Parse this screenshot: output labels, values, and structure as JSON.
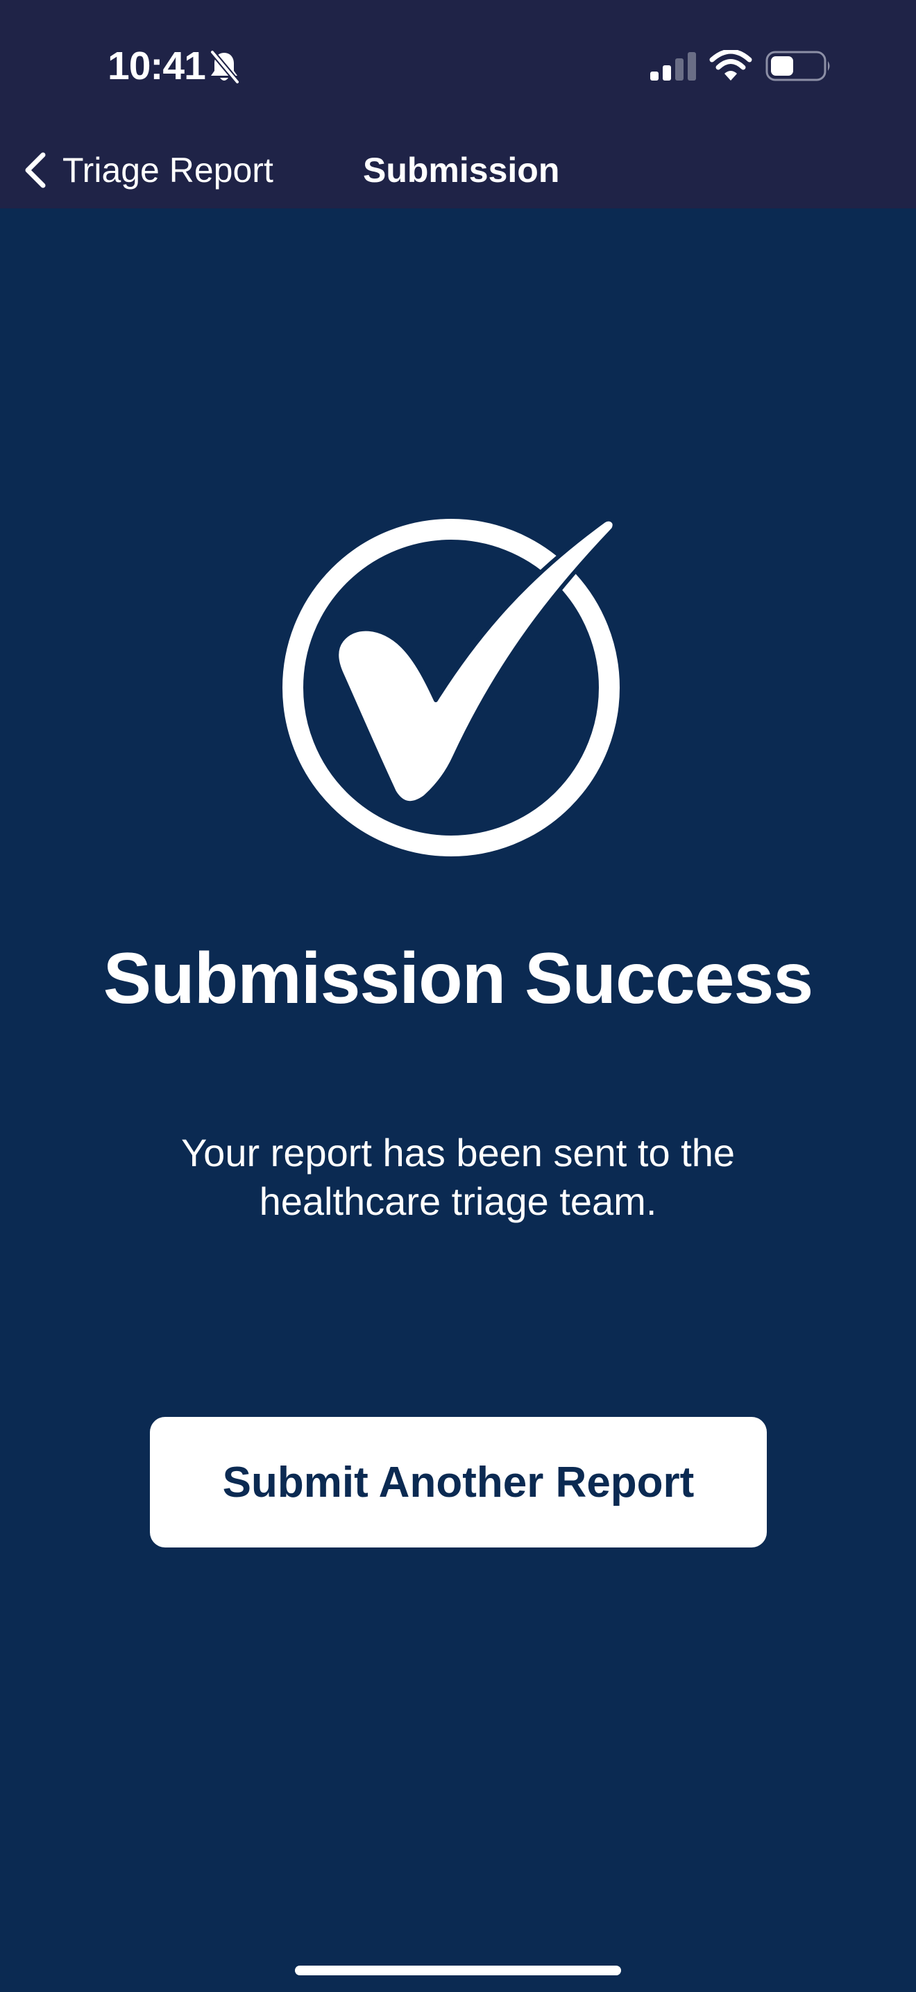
{
  "status_bar": {
    "time": "10:41",
    "icons": [
      "mute-bell-icon",
      "cellular-signal-icon",
      "wifi-icon",
      "battery-icon"
    ]
  },
  "nav": {
    "back_label": "Triage Report",
    "title": "Submission"
  },
  "main": {
    "icon": "check-circle-icon",
    "title": "Submission Success",
    "message": "Your report has been sent to the healthcare triage team.",
    "button_label": "Submit Another Report"
  },
  "colors": {
    "header_background": "#1f2347",
    "page_background": "#0b2a52",
    "button_background": "#ffffff",
    "button_text": "#0b2a52"
  }
}
